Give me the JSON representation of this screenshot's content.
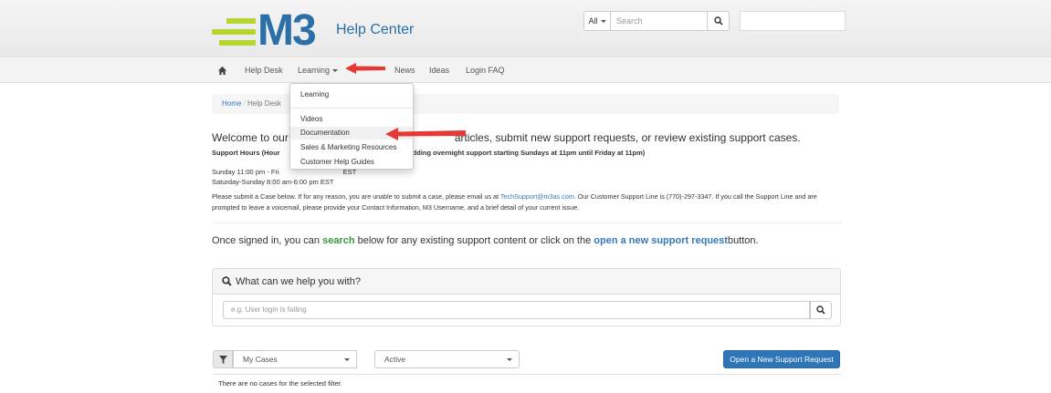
{
  "header": {
    "logo_mark": "M3",
    "logo_text": "Help Center",
    "search_scope": "All",
    "search_placeholder": "Search"
  },
  "nav": {
    "items": [
      {
        "label": "Help Desk"
      },
      {
        "label": "Learning"
      },
      {
        "label": "News"
      },
      {
        "label": "Ideas"
      },
      {
        "label": "Login FAQ"
      }
    ]
  },
  "dropdown": {
    "items": [
      {
        "label": "Learning"
      },
      {
        "label": "Videos"
      },
      {
        "label": "Documentation"
      },
      {
        "label": "Sales & Marketing Resources"
      },
      {
        "label": "Customer Help Guides"
      }
    ]
  },
  "breadcrumb": {
    "home": "Home",
    "current": "Help Desk"
  },
  "content": {
    "welcome_left": "Welcome to our H",
    "welcome_right": "articles, submit new support requests, or review existing support cases.",
    "hours_title_left": "Support Hours (Hour",
    "hours_title_right": "w adding overnight support starting Sundays at 11pm until Friday at 11pm)",
    "hours_line1_left": "Sunday 11:00 pm - Fri",
    "hours_line1_right": "EST",
    "hours_line2": "Saturday-Sunday  8:00 am-6:00 pm EST",
    "para_1": "Please submit a Case below.  If for any reason, you are unable to submit a case, please email us at ",
    "para_email": "TechSupport@m3as.com",
    "para_2": ". Our Customer Support Line is (770)-297-3347. If you call the Support Line and are prompted to leave a voicemail, please provide your Contact Information, M3 Username, and a brief detail of your current issue.",
    "signed_in_1": "Once signed in, you can ",
    "signed_in_search": "search",
    "signed_in_2": " below for any existing support content or click on the ",
    "signed_in_link": "open a new support request",
    "signed_in_3": "button."
  },
  "help_panel": {
    "title": "What can we help you with?",
    "placeholder": "e.g. User login is failing"
  },
  "cases": {
    "filter_value": "My Cases",
    "status_value": "Active",
    "new_request_label": "Open a New Support Request",
    "empty_text": "There are no cases for the selected filter."
  },
  "colors": {
    "brand_blue": "#2a6fa8",
    "brand_green": "#b5d531",
    "primary_button": "#2e76b8",
    "search_green": "#3c9a3c",
    "arrow_red": "#e53935"
  }
}
